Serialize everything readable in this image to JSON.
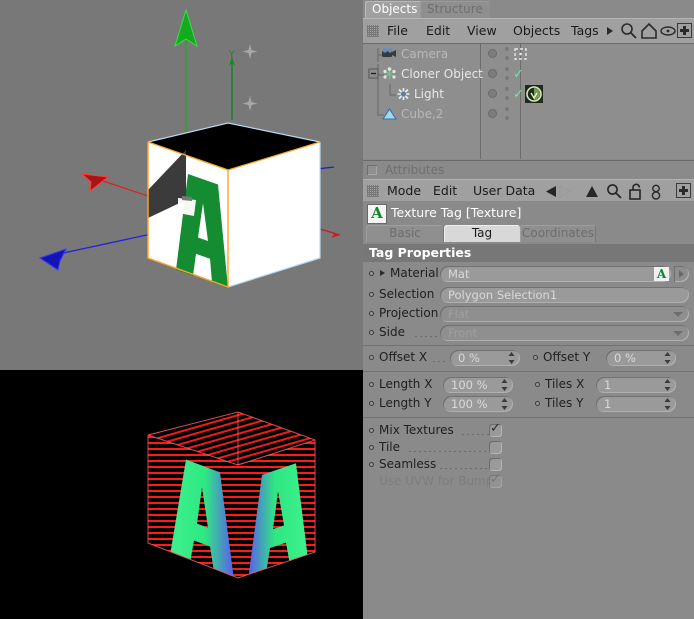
{
  "app": {
    "tabs": [
      {
        "label": "Objects",
        "active": true
      },
      {
        "label": "Structure",
        "active": false
      }
    ],
    "menubar": {
      "items": [
        "File",
        "Edit",
        "View",
        "Objects",
        "Tags"
      ],
      "icons": [
        "expand-arrow-icon",
        "search-icon",
        "home-icon",
        "eye-icon",
        "maximize-icon"
      ]
    }
  },
  "object_tree": {
    "rows": [
      {
        "name": "Camera",
        "icon": "camera-icon",
        "indent": 22,
        "dim": true,
        "visibility_marker": "dotted-frame-icon",
        "tags": []
      },
      {
        "name": "Cloner Object",
        "icon": "cloner-icon",
        "indent": 22,
        "dim": false,
        "visibility_marker": "check-icon",
        "tags": []
      },
      {
        "name": "Light",
        "icon": "light-icon",
        "indent": 38,
        "dim": false,
        "visibility_marker": "check-icon",
        "tags": [
          "light-tag-icon"
        ]
      },
      {
        "name": "Cube,2",
        "icon": "polygon-icon",
        "indent": 22,
        "dim": true,
        "visibility_marker": "",
        "tags": [
          "material-sphere-icon",
          "checker-texture-icon",
          "stripes-texture-icon",
          "selection-tag-icon",
          "texture-tag-b-icon",
          "selection-tag-icon",
          "texture-tag-a-icon"
        ]
      }
    ]
  },
  "attributes": {
    "panel_title": "Attributes",
    "menu_items": [
      "Mode",
      "Edit",
      "User Data"
    ],
    "toolbar_icons": [
      "back-arrow-icon",
      "forward-arrow-icon",
      "up-arrow-icon",
      "search-icon",
      "lock-open-icon",
      "link-icon",
      "maximize-icon"
    ],
    "object_title": "Texture Tag [Texture]",
    "object_icon": "A",
    "tabs": [
      {
        "label": "Basic",
        "active": false
      },
      {
        "label": "Tag",
        "active": true
      },
      {
        "label": "Coordinates",
        "active": false
      }
    ],
    "section_header": "Tag Properties",
    "fields": {
      "material": {
        "label": "Material",
        "value": "Mat",
        "badge": "A"
      },
      "selection": {
        "label": "Selection",
        "value": "Polygon Selection1"
      },
      "projection": {
        "label": "Projection",
        "value": "Flat"
      },
      "side": {
        "label": "Side",
        "value": "Front"
      },
      "offset_x": {
        "label": "Offset X",
        "value": "0 %"
      },
      "offset_y": {
        "label": "Offset Y",
        "value": "0 %"
      },
      "length_x": {
        "label": "Length X",
        "value": "100 %"
      },
      "length_y": {
        "label": "Length Y",
        "value": "100 %"
      },
      "tiles_x": {
        "label": "Tiles X",
        "value": "1"
      },
      "tiles_y": {
        "label": "Tiles Y",
        "value": "1"
      }
    },
    "checkboxes": [
      {
        "label": "Mix Textures",
        "checked": true,
        "disabled": false
      },
      {
        "label": "Tile",
        "checked": false,
        "disabled": false
      },
      {
        "label": "Seamless",
        "checked": false,
        "disabled": false
      },
      {
        "label": "Use UVW for Bump",
        "checked": true,
        "disabled": true
      }
    ]
  },
  "viewports": {
    "perspective": {
      "background": "#787878",
      "axis_colors": {
        "x": "#cc2222",
        "y": "#11aa22",
        "z": "#2222cc"
      },
      "object_label": "Y",
      "cube_faces": {
        "front": "#ffffff",
        "top": "#000000",
        "right": "#ffffff"
      },
      "letter": "A",
      "letter_color": "#158c32",
      "selection_outline": "#ffa52a"
    },
    "render": {
      "background": "#000000",
      "letter": "A",
      "letter_colors": [
        "#2ee882",
        "#5b5bf0"
      ],
      "wire_color": "#ff2020"
    }
  }
}
